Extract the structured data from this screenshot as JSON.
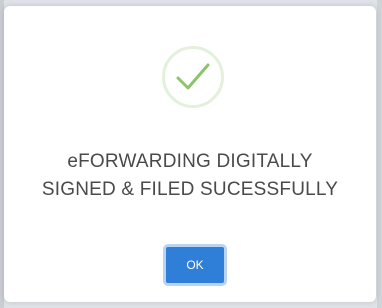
{
  "dialog": {
    "icon": "checkmark-icon",
    "message_line1": "eFORWARDING DIGITALLY",
    "message_line2": "SIGNED & FILED SUCESSFULLY",
    "ok_label": "OK"
  },
  "colors": {
    "check": "#8cc46a",
    "circle": "#e3f1dc",
    "button": "#2f7ed8",
    "button_border": "#b9d4f2",
    "text": "#4a4a4a"
  }
}
